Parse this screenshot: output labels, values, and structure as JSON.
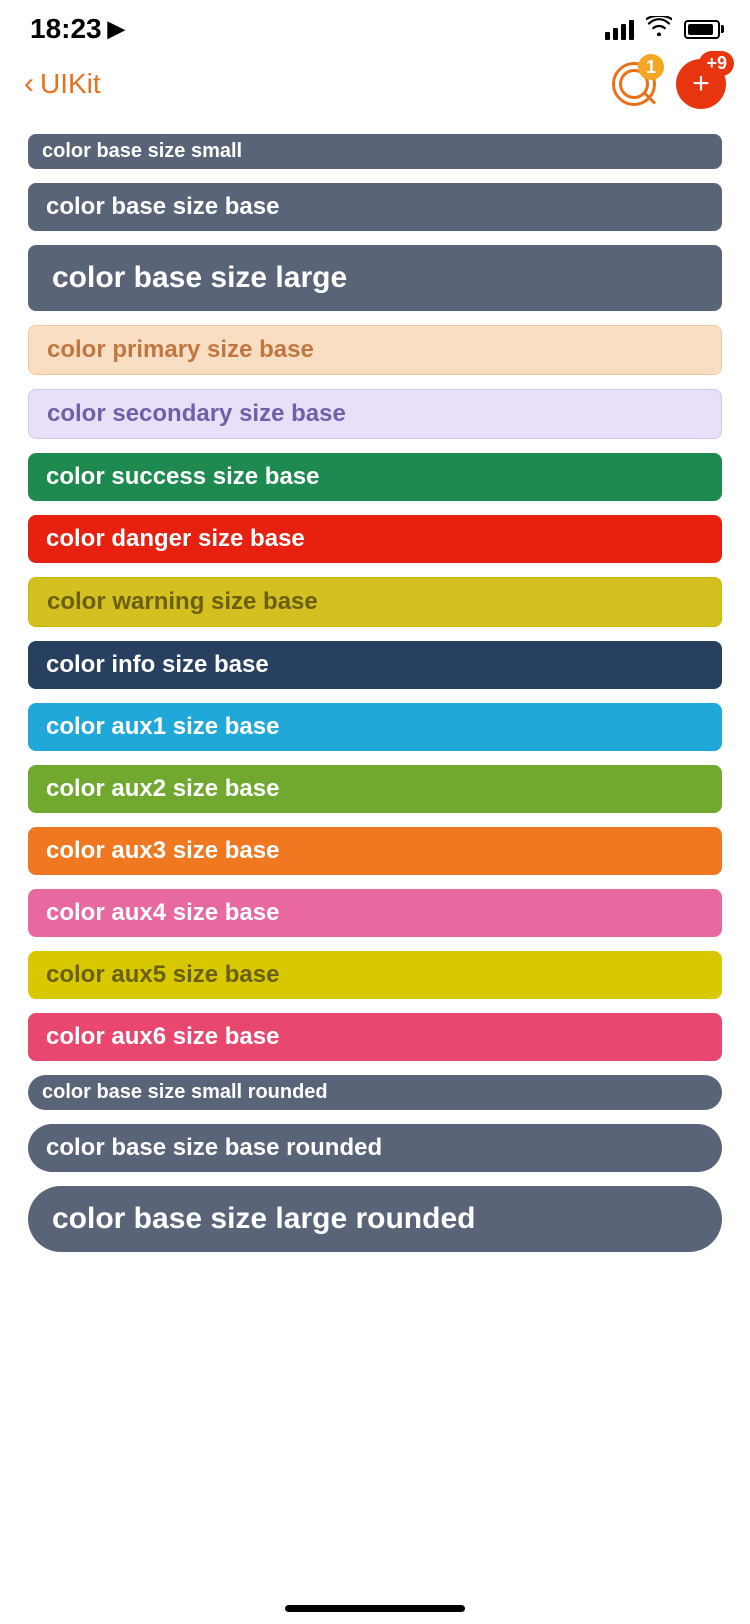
{
  "statusBar": {
    "time": "18:23",
    "notificationCount": "1",
    "addBadge": "+9"
  },
  "header": {
    "backLabel": "UIKit",
    "searchBadge": "1",
    "addBadge": "+9"
  },
  "chips": [
    {
      "id": "chip-base-small",
      "label": "color base size small",
      "colorClass": "chip-color-base",
      "sizeClass": "chip-small",
      "rounded": false
    },
    {
      "id": "chip-base-base",
      "label": "color base size base",
      "colorClass": "chip-color-base",
      "sizeClass": "chip-base",
      "rounded": false
    },
    {
      "id": "chip-base-large",
      "label": "color base size large",
      "colorClass": "chip-color-base",
      "sizeClass": "chip-large",
      "rounded": false
    },
    {
      "id": "chip-primary-base",
      "label": "color primary size base",
      "colorClass": "chip-color-primary",
      "sizeClass": "chip-base",
      "rounded": false
    },
    {
      "id": "chip-secondary-base",
      "label": "color secondary size base",
      "colorClass": "chip-color-secondary",
      "sizeClass": "chip-base",
      "rounded": false
    },
    {
      "id": "chip-success-base",
      "label": "color success size base",
      "colorClass": "chip-color-success",
      "sizeClass": "chip-base",
      "rounded": false
    },
    {
      "id": "chip-danger-base",
      "label": "color danger size base",
      "colorClass": "chip-color-danger",
      "sizeClass": "chip-base",
      "rounded": false
    },
    {
      "id": "chip-warning-base",
      "label": "color warning size base",
      "colorClass": "chip-color-warning",
      "sizeClass": "chip-base",
      "rounded": false
    },
    {
      "id": "chip-info-base",
      "label": "color info size base",
      "colorClass": "chip-color-info",
      "sizeClass": "chip-base",
      "rounded": false
    },
    {
      "id": "chip-aux1-base",
      "label": "color aux1 size base",
      "colorClass": "chip-color-aux1",
      "sizeClass": "chip-base",
      "rounded": false
    },
    {
      "id": "chip-aux2-base",
      "label": "color aux2 size base",
      "colorClass": "chip-color-aux2",
      "sizeClass": "chip-base",
      "rounded": false
    },
    {
      "id": "chip-aux3-base",
      "label": "color aux3 size base",
      "colorClass": "chip-color-aux3",
      "sizeClass": "chip-base",
      "rounded": false
    },
    {
      "id": "chip-aux4-base",
      "label": "color aux4 size base",
      "colorClass": "chip-color-aux4",
      "sizeClass": "chip-base",
      "rounded": false
    },
    {
      "id": "chip-aux5-base",
      "label": "color aux5 size base",
      "colorClass": "chip-color-aux5",
      "sizeClass": "chip-base",
      "rounded": false
    },
    {
      "id": "chip-aux6-base",
      "label": "color aux6 size base",
      "colorClass": "chip-color-aux6",
      "sizeClass": "chip-base",
      "rounded": false
    },
    {
      "id": "chip-base-small-rounded",
      "label": "color base size small rounded",
      "colorClass": "chip-color-base",
      "sizeClass": "chip-small",
      "rounded": true
    },
    {
      "id": "chip-base-base-rounded",
      "label": "color base size base rounded",
      "colorClass": "chip-color-base",
      "sizeClass": "chip-base",
      "rounded": true
    },
    {
      "id": "chip-base-large-rounded",
      "label": "color base size large rounded",
      "colorClass": "chip-color-base",
      "sizeClass": "chip-large",
      "rounded": true
    }
  ]
}
